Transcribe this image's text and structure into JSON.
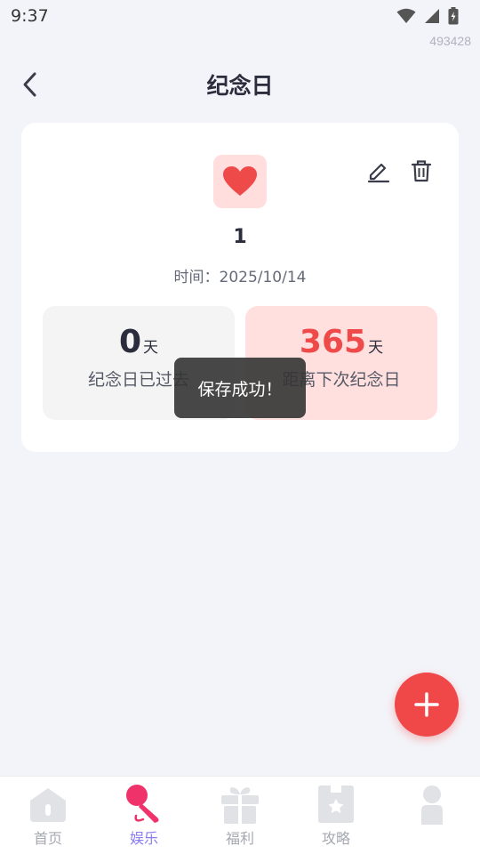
{
  "status_bar": {
    "time": "9:37"
  },
  "device_id": "493428",
  "header": {
    "title": "纪念日"
  },
  "card": {
    "icon": "heart-icon",
    "name": "1",
    "date_text": "时间：2025/10/14",
    "passed": {
      "number": "0",
      "unit": "天",
      "label": "纪念日已过去"
    },
    "next": {
      "number": "365",
      "unit": "天",
      "label": "距离下次纪念日"
    }
  },
  "toast": "保存成功！",
  "colors": {
    "accent": "#f04848",
    "nav_active": "#8a7cf2",
    "heart": "#ef4a4a"
  },
  "bottom_nav": {
    "items": [
      {
        "label": "首页",
        "icon": "home-icon",
        "active": false
      },
      {
        "label": "娱乐",
        "icon": "microphone-icon",
        "active": true
      },
      {
        "label": "福利",
        "icon": "gift-icon",
        "active": false
      },
      {
        "label": "攻略",
        "icon": "star-book-icon",
        "active": false
      },
      {
        "label": "",
        "icon": "person-icon",
        "active": false
      }
    ]
  }
}
